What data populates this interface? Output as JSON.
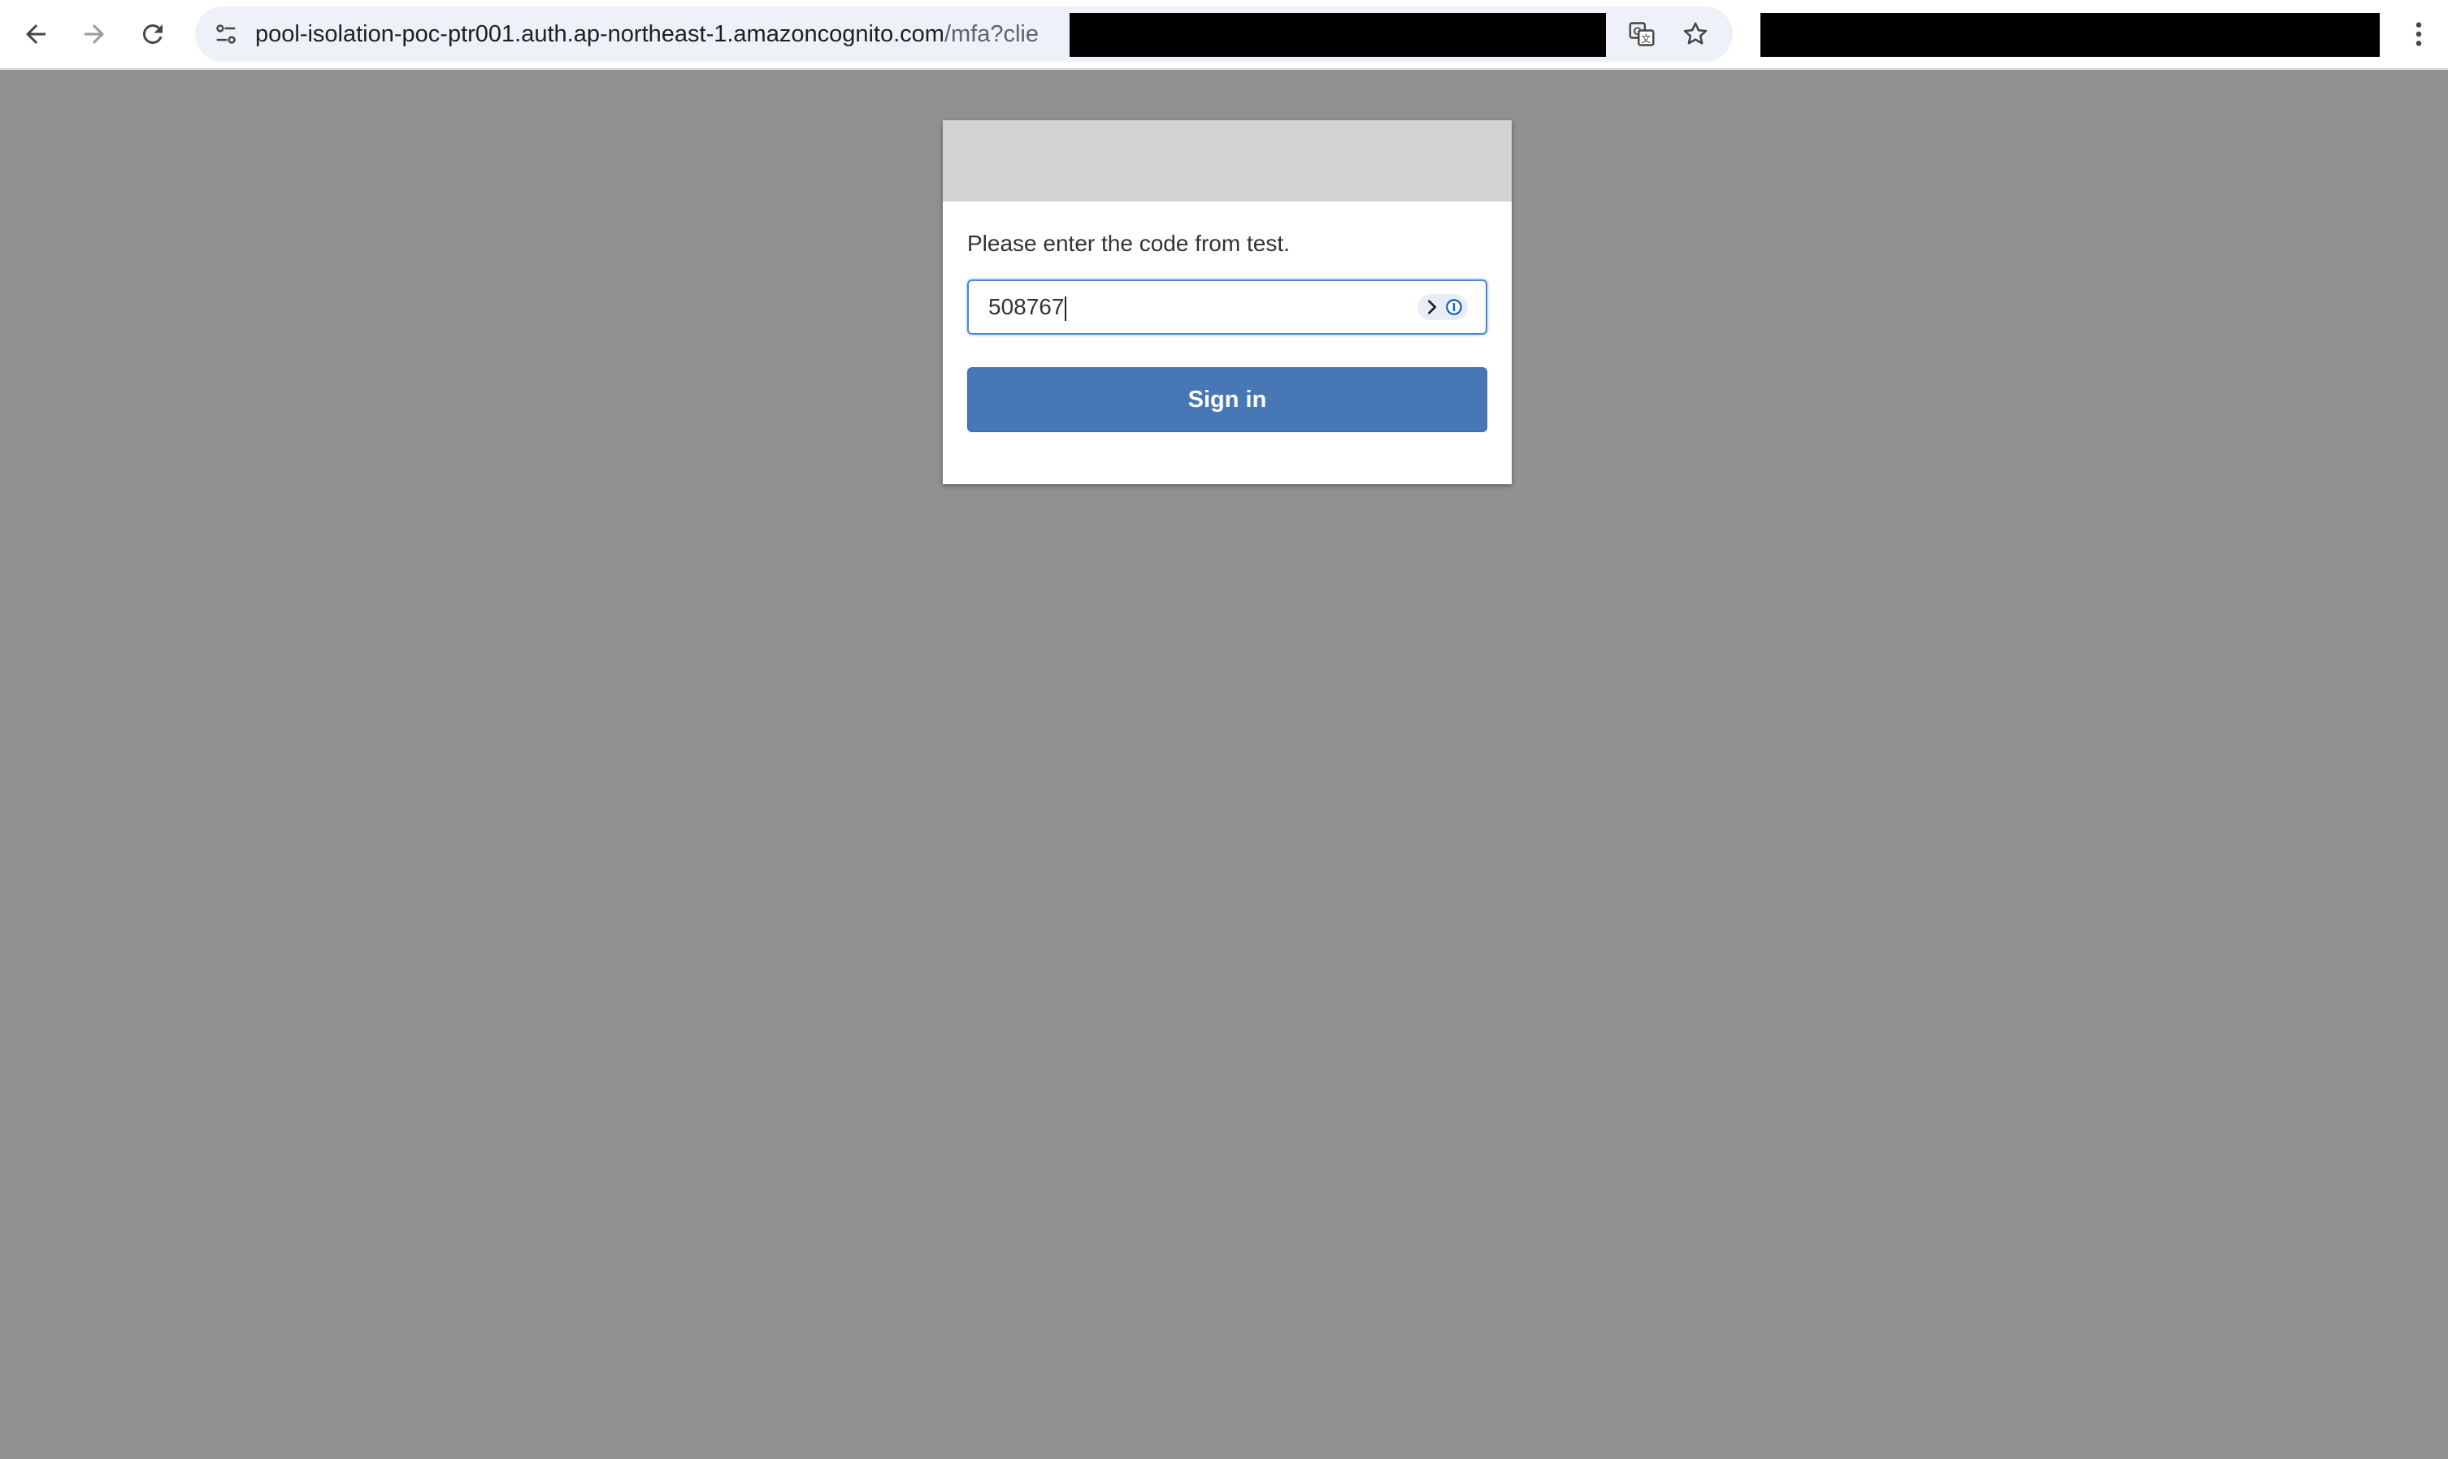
{
  "browser": {
    "url_main": "pool-isolation-poc-ptr001.auth.ap-northeast-1.amazoncognito.com",
    "url_path": "/mfa?clie",
    "icons": {
      "back": "back-arrow-icon",
      "forward": "forward-arrow-icon",
      "reload": "reload-icon",
      "site_info": "tune-icon",
      "translate": "translate-icon",
      "bookmark": "star-icon",
      "menu": "kebab-menu-icon"
    }
  },
  "mfa": {
    "prompt": "Please enter the code from test.",
    "code_value": "508767",
    "submit_label": "Sign in"
  },
  "colors": {
    "page_background": "#919191",
    "banner": "#d2d2d2",
    "button": "#4778b5",
    "input_focus": "#4b86d6"
  }
}
